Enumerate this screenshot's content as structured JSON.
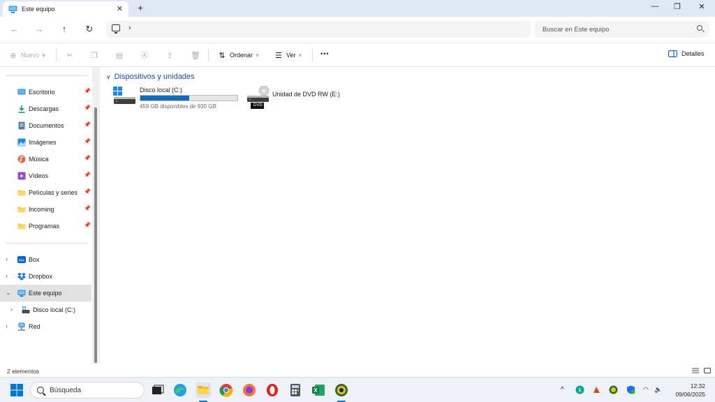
{
  "window": {
    "tab_title": "Este equipo",
    "tab_close": "✕",
    "new_tab": "+",
    "minimize": "—",
    "maximize": "❐",
    "close": "✕"
  },
  "address": {
    "separator": "›",
    "search_placeholder": "Buscar en Este equipo"
  },
  "toolbar": {
    "new_label": "Nuevo",
    "sort_label": "Ordenar",
    "view_label": "Ver",
    "more_label": "•••",
    "details_label": "Detalles"
  },
  "sidebar": {
    "quick_access": [
      {
        "label": "Escritorio",
        "icon": "desktop-icon"
      },
      {
        "label": "Descargas",
        "icon": "download-icon"
      },
      {
        "label": "Documentos",
        "icon": "documents-icon"
      },
      {
        "label": "Imágenes",
        "icon": "pictures-icon"
      },
      {
        "label": "Música",
        "icon": "music-icon"
      },
      {
        "label": "Vídeos",
        "icon": "videos-icon"
      },
      {
        "label": "Películas y series",
        "icon": "folder-icon"
      },
      {
        "label": "Incoming",
        "icon": "folder-icon"
      },
      {
        "label": "Programas",
        "icon": "folder-icon"
      }
    ],
    "locations": [
      {
        "label": "Box",
        "icon": "box-icon"
      },
      {
        "label": "Dropbox",
        "icon": "dropbox-icon"
      },
      {
        "label": "Este equipo",
        "icon": "this-pc-icon",
        "selected": true
      },
      {
        "label": "Disco local (C:)",
        "icon": "drive-icon"
      },
      {
        "label": "Red",
        "icon": "network-icon"
      }
    ]
  },
  "content": {
    "group_title": "Dispositivos y unidades",
    "drives": [
      {
        "name": "Disco local (C:)",
        "info": "459 GB disponibles de 930 GB",
        "used_fraction": 0.506
      },
      {
        "name": "Unidad de DVD RW (E:)",
        "badge": "DVD"
      }
    ]
  },
  "status": {
    "item_count": "2 elementos"
  },
  "taskbar": {
    "search_placeholder": "Búsqueda",
    "tray_chevron": "^",
    "time": "12:32",
    "date": "09/06/2025"
  },
  "colors": {
    "accent": "#0f6cbd",
    "titlebar_bg": "#dfe8f4",
    "group_header": "#1b4aa8"
  }
}
